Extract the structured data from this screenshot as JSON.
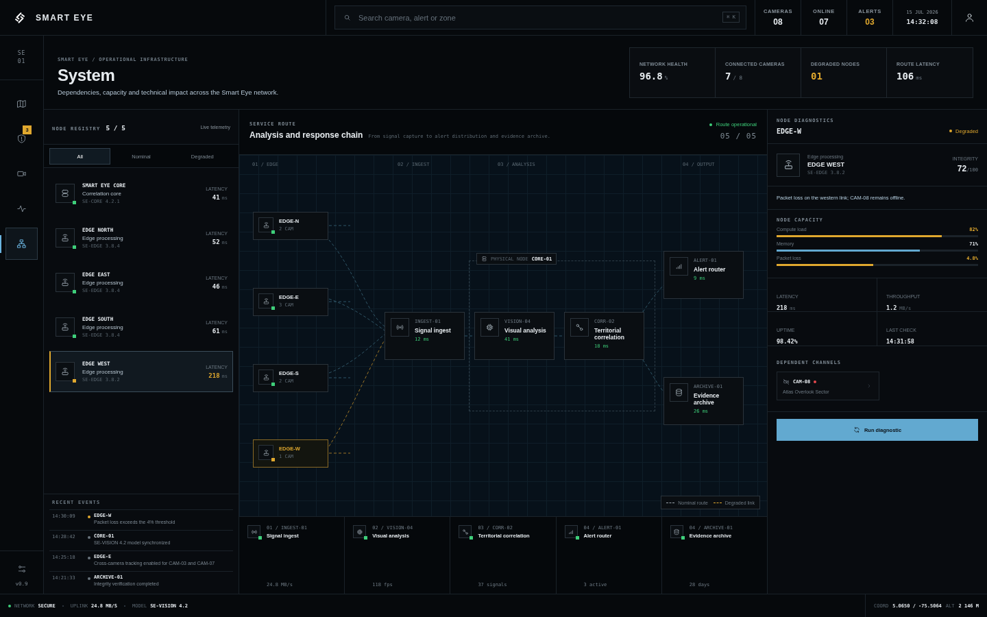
{
  "brand": {
    "name": "SMART EYE"
  },
  "search": {
    "placeholder": "Search camera, alert or zone",
    "shortcut": "⌘ K"
  },
  "top_stats": [
    {
      "label": "CAMERAS",
      "value": "08",
      "warning": false
    },
    {
      "label": "ONLINE",
      "value": "07",
      "warning": false
    },
    {
      "label": "ALERTS",
      "value": "03",
      "warning": true
    }
  ],
  "clock": {
    "date": "15 JUL 2026",
    "time": "14:32:08"
  },
  "rail": {
    "code": "SE 01",
    "items": [
      {
        "kind": "map",
        "selected": false
      },
      {
        "kind": "shield",
        "badge": "3",
        "selected": false
      },
      {
        "kind": "camera",
        "selected": false
      },
      {
        "kind": "pulse",
        "selected": false
      },
      {
        "kind": "network",
        "selected": true
      }
    ],
    "version": "v0.9"
  },
  "header": {
    "breadcrumb": "SMART EYE / OPERATIONAL INFRASTRUCTURE",
    "title": "System",
    "subtitle": "Dependencies, capacity and technical impact across the Smart Eye network."
  },
  "kpis": [
    {
      "label": "NETWORK HEALTH",
      "value": "96.8",
      "unit": "%",
      "warning": false
    },
    {
      "label": "CONNECTED CAMERAS",
      "value": "7",
      "unit": "/ 8",
      "warning": false
    },
    {
      "label": "DEGRADED NODES",
      "value": "01",
      "warning": true
    },
    {
      "label": "ROUTE LATENCY",
      "value": "106",
      "unit": "ms",
      "warning": false
    }
  ],
  "registry": {
    "title": "NODE REGISTRY",
    "count": "5 / 5",
    "note": "Live telemetry",
    "filters": [
      {
        "label": "All",
        "selected": true
      },
      {
        "label": "Nominal",
        "selected": false
      },
      {
        "label": "Degraded",
        "selected": false
      }
    ],
    "nodes": [
      {
        "name": "SMART EYE CORE",
        "role": "Correlation core",
        "version": "SE-CORE 4.2.1",
        "latency_label": "LATENCY",
        "latency": "41",
        "unit": "ms",
        "kind": "server",
        "degraded": false,
        "selected": false
      },
      {
        "name": "EDGE NORTH",
        "role": "Edge processing",
        "version": "SE-EDGE 3.8.4",
        "latency_label": "LATENCY",
        "latency": "52",
        "unit": "ms",
        "kind": "router",
        "degraded": false,
        "selected": false
      },
      {
        "name": "EDGE EAST",
        "role": "Edge processing",
        "version": "SE-EDGE 3.8.4",
        "latency_label": "LATENCY",
        "latency": "46",
        "unit": "ms",
        "kind": "router",
        "degraded": false,
        "selected": false
      },
      {
        "name": "EDGE SOUTH",
        "role": "Edge processing",
        "version": "SE-EDGE 3.8.4",
        "latency_label": "LATENCY",
        "latency": "61",
        "unit": "ms",
        "kind": "router",
        "degraded": false,
        "selected": false
      },
      {
        "name": "EDGE WEST",
        "role": "Edge processing",
        "version": "SE-EDGE 3.8.2",
        "latency_label": "LATENCY",
        "latency": "218",
        "unit": "ms",
        "kind": "router",
        "degraded": true,
        "selected": true
      }
    ]
  },
  "events": {
    "title": "RECENT EVENTS",
    "items": [
      {
        "time": "14:30:09",
        "source": "EDGE-W",
        "message": "Packet loss exceeds the 4% threshold",
        "color": "#e0a82e"
      },
      {
        "time": "14:28:42",
        "source": "CORE-01",
        "message": "SE-VISION 4.2 model synchronized",
        "color": "#69747d"
      },
      {
        "time": "14:25:18",
        "source": "EDGE-E",
        "message": "Cross-camera tracking enabled for CAM-03 and CAM-07",
        "color": "#69747d"
      },
      {
        "time": "14:21:33",
        "source": "ARCHIVE-01",
        "message": "Integrity verification completed",
        "color": "#69747d"
      }
    ]
  },
  "route": {
    "eyebrow": "SERVICE ROUTE",
    "title": "Analysis and response chain",
    "description": "From signal capture to alert distribution and evidence archive.",
    "operational": true,
    "status_label": "Route operational",
    "count": "05 / 05",
    "columns": [
      "01 / EDGE",
      "02 / INGEST",
      "03 / ANALYSIS",
      "04 / OUTPUT"
    ],
    "edges": [
      {
        "id": "EDGE-N",
        "cams": "2 CAM",
        "degraded": false
      },
      {
        "id": "EDGE-E",
        "cams": "3 CAM",
        "degraded": false
      },
      {
        "id": "EDGE-S",
        "cams": "2 CAM",
        "degraded": false
      },
      {
        "id": "EDGE-W",
        "cams": "1 CAM",
        "degraded": true
      }
    ],
    "group": {
      "caption": "PHYSICAL NODE",
      "name": "CORE-01"
    },
    "stages": [
      {
        "code": "INGEST-01",
        "name": "Signal ingest",
        "latency": "12 ms",
        "kind": "broadcast"
      },
      {
        "code": "VISION-04",
        "name": "Visual analysis",
        "latency": "41 ms",
        "kind": "chip"
      },
      {
        "code": "CORR-02",
        "name": "Territorial correlation",
        "latency": "18 ms",
        "kind": "link"
      }
    ],
    "outputs": [
      {
        "code": "ALERT-01",
        "name": "Alert router",
        "latency": "9 ms",
        "kind": "bars"
      },
      {
        "code": "ARCHIVE-01",
        "name": "Evidence archive",
        "latency": "26 ms",
        "kind": "database"
      }
    ],
    "legend": [
      {
        "label": "Nominal route",
        "color": "#9aa4ad"
      },
      {
        "label": "Degraded link",
        "color": "#e0a82e"
      }
    ]
  },
  "pipeline": [
    {
      "step": "01 / INGEST-01",
      "name": "Signal ingest",
      "metric": "24.8 MB/s",
      "kind": "broadcast",
      "online": true
    },
    {
      "step": "02 / VISION-04",
      "name": "Visual analysis",
      "metric": "118 fps",
      "kind": "chip",
      "online": true
    },
    {
      "step": "03 / CORR-02",
      "name": "Territorial correlation",
      "metric": "37 signals",
      "kind": "link",
      "online": true
    },
    {
      "step": "04 / ALERT-01",
      "name": "Alert router",
      "metric": "3 active",
      "kind": "bars",
      "online": true
    },
    {
      "step": "04 / ARCHIVE-01",
      "name": "Evidence archive",
      "metric": "28 days",
      "kind": "database",
      "online": true
    }
  ],
  "diagnostics": {
    "eyebrow": "NODE DIAGNOSTICS",
    "id": "EDGE-W",
    "degraded": true,
    "status_label": "Degraded",
    "node": {
      "kind": "router",
      "role": "Edge processing",
      "name": "EDGE WEST",
      "version": "SE-EDGE 3.8.2",
      "integrity_label": "INTEGRITY",
      "integrity": "72",
      "integrity_max": "/100"
    },
    "message": "Packet loss on the western link; CAM-08 remains offline.",
    "capacity_title": "NODE CAPACITY",
    "capacity": [
      {
        "label": "Compute load",
        "value": "82%",
        "level": 0.82,
        "warning": true
      },
      {
        "label": "Memory",
        "value": "71%",
        "level": 0.71,
        "warning": false
      },
      {
        "label": "Packet loss",
        "value": "4.8%",
        "level": 0.48,
        "warning": true
      }
    ],
    "metrics": [
      {
        "label": "LATENCY",
        "value": "218",
        "unit": "ms"
      },
      {
        "label": "THROUGHPUT",
        "value": "1.2",
        "unit": "MB/s"
      },
      {
        "label": "UPTIME",
        "value": "98.42%"
      },
      {
        "label": "LAST CHECK",
        "value": "14:31:58"
      }
    ],
    "channels_title": "DEPENDENT CHANNELS",
    "channels": [
      {
        "name": "CAM-08",
        "location": "Atlas Overlook Sector",
        "offline": true
      }
    ],
    "action": "Run diagnostic"
  },
  "status_bar": {
    "items": [
      {
        "label": "NETWORK",
        "value": "SECURE",
        "online": true
      },
      {
        "label": "UPLINK",
        "value": "24.8 MB/S"
      },
      {
        "label": "MODEL",
        "value": "SE-VISION 4.2"
      }
    ],
    "coord_label": "COORD",
    "coord": "5.0650 / -75.5064",
    "alt_label": "ALT",
    "alt": "2 146 M"
  }
}
